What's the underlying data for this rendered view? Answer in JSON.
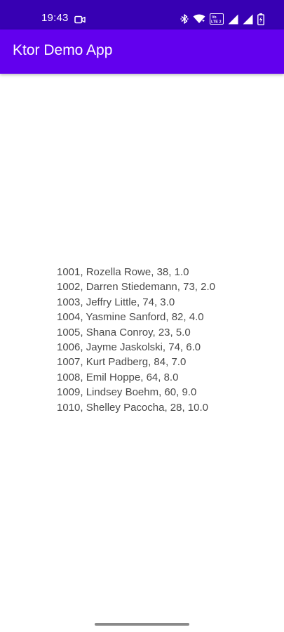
{
  "status_bar": {
    "time": "19:43",
    "lte_label": "Vo LTE 2",
    "icons": [
      "video-camera-icon",
      "bluetooth-icon",
      "wifi-icon",
      "volte-icon",
      "cell-signal-icon",
      "cell-signal-icon",
      "battery-icon"
    ]
  },
  "app_bar": {
    "title": "Ktor Demo App"
  },
  "users": [
    "1001, Rozella Rowe, 38, 1.0",
    "1002, Darren Stiedemann, 73, 2.0",
    "1003, Jeffry Little, 74, 3.0",
    "1004, Yasmine Sanford, 82, 4.0",
    "1005, Shana Conroy, 23, 5.0",
    "1006, Jayme Jaskolski, 74, 6.0",
    "1007, Kurt Padberg, 84, 7.0",
    "1008, Emil Hoppe, 64, 8.0",
    "1009, Lindsey Boehm, 60, 9.0",
    "1010, Shelley Pacocha, 28, 10.0"
  ],
  "colors": {
    "status_bar": "#3700b3",
    "app_bar": "#6200ee",
    "text": "#4a4a4a"
  }
}
